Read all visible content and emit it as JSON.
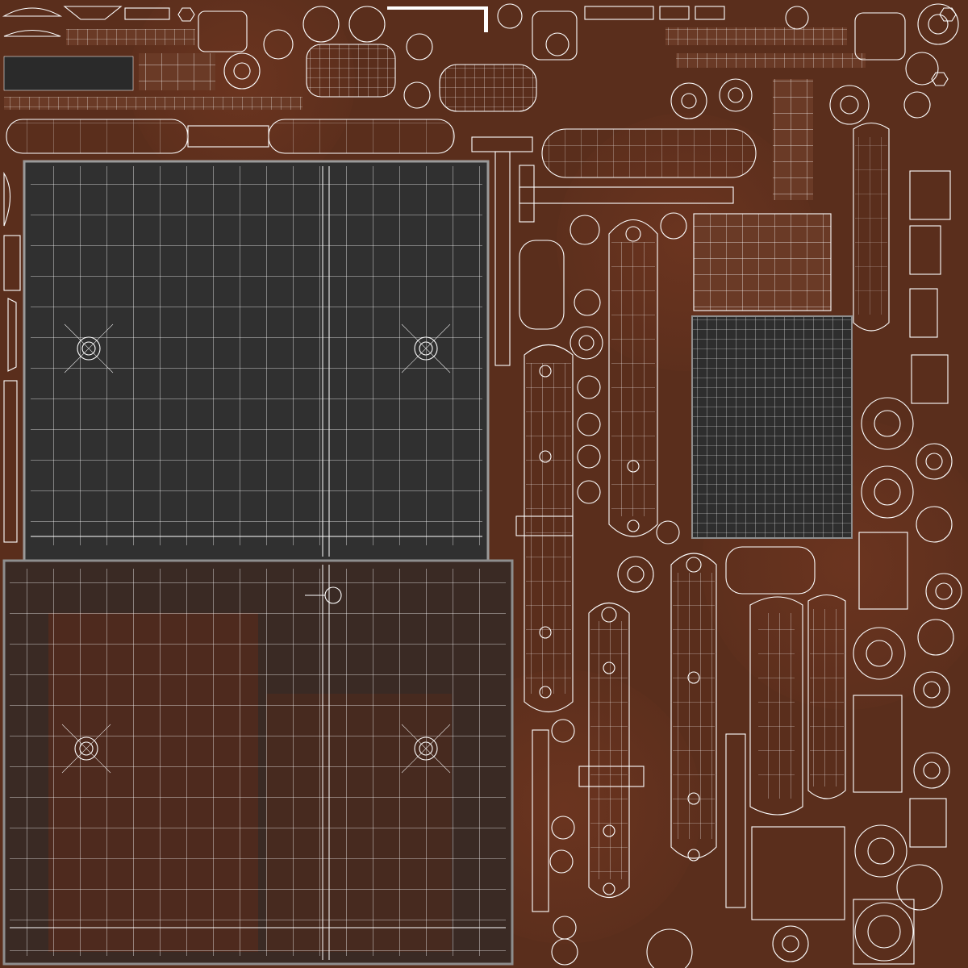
{
  "image": {
    "kind": "uv-texture-atlas-with-wireframe",
    "has_text": false
  },
  "colors": {
    "rust_base": "#5a2e1c",
    "rust_dark": "#3e1f12",
    "rust_light": "#7a4a32",
    "metal_dark": "#2a2a2a",
    "metal_mid": "#3a3a3a",
    "metal_edge": "#8e8e8e",
    "wire": "#ffffff"
  },
  "icons": [
    "bolt-hole-icon",
    "rivet-ring-icon",
    "sphere-icon",
    "hex-nut-icon"
  ]
}
